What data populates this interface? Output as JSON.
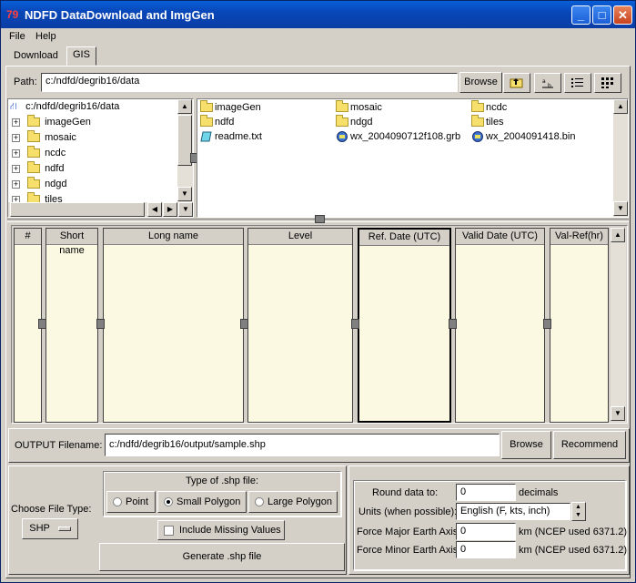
{
  "window": {
    "title": "NDFD DataDownload and ImgGen",
    "icon": "app-logo-icon"
  },
  "menu": {
    "file": "File",
    "help": "Help"
  },
  "tabs": [
    {
      "label": "Download"
    },
    {
      "label": "GIS"
    }
  ],
  "path": {
    "label": "Path:",
    "value": "c:/ndfd/degrib16/data",
    "browse": "Browse"
  },
  "tree": {
    "root": "c:/ndfd/degrib16/data",
    "items": [
      "imageGen",
      "mosaic",
      "ncdc",
      "ndfd",
      "ndgd",
      "tiles"
    ]
  },
  "files": [
    [
      "imageGen",
      "mosaic",
      "ncdc"
    ],
    [
      "ndfd",
      "ndgd",
      "tiles"
    ],
    [
      "readme.txt",
      "wx_2004090712f108.grb",
      "wx_2004091418.bin"
    ]
  ],
  "table": {
    "columns": [
      "#",
      "Short name",
      "Long name",
      "Level",
      "Ref. Date (UTC)",
      "Valid Date (UTC)",
      "Val-Ref(hr)"
    ]
  },
  "output": {
    "label": "OUTPUT Filename:",
    "value": "c:/ndfd/degrib16/output/sample.shp",
    "browse": "Browse",
    "recommend": "Recommend"
  },
  "filetype": {
    "label": "Choose File Type:",
    "value": "SHP"
  },
  "shp": {
    "title": "Type of .shp file:",
    "options": [
      "Point",
      "Small Polygon",
      "Large Polygon"
    ],
    "selected": "Small Polygon",
    "include_missing": "Include Missing Values",
    "generate": "Generate .shp file"
  },
  "settings": {
    "round_label": "Round data to:",
    "round_value": "0",
    "round_unit": "decimals",
    "units_label": "Units (when possible):",
    "units_value": "English (F, kts, inch)",
    "major_label": "Force Major Earth Axis",
    "major_value": "0",
    "major_note": "km (NCEP used 6371.2)",
    "minor_label": "Force Minor Earth Axis",
    "minor_value": "0",
    "minor_note": "km (NCEP used 6371.2)"
  }
}
